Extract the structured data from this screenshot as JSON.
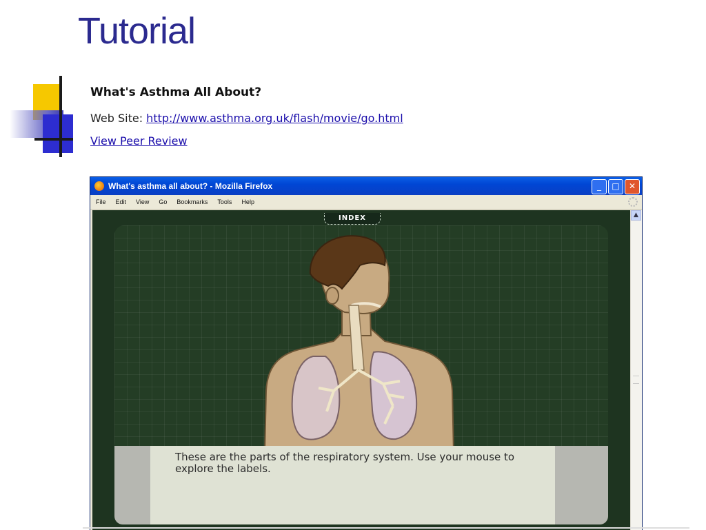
{
  "slide": {
    "title": "Tutorial",
    "heading": "What's Asthma All About?",
    "website_label": "Web Site: ",
    "website_url": "http://www.asthma.org.uk/flash/movie/go.html",
    "peer_review_link": "View Peer Review"
  },
  "browser": {
    "window_title": "What's asthma all about? - Mozilla Firefox",
    "menu": [
      "File",
      "Edit",
      "View",
      "Go",
      "Bookmarks",
      "Tools",
      "Help"
    ],
    "buttons": {
      "minimize": "_",
      "maximize": "□",
      "close": "✕"
    }
  },
  "flash": {
    "index_label": "INDEX",
    "caption": "These are the parts of the respiratory system.  Use your mouse to explore the labels."
  },
  "colors": {
    "title_blue": "#2b2a8f",
    "link_blue": "#1a0dab",
    "xp_titlebar": "#0046d4",
    "board_green": "#243d25"
  }
}
